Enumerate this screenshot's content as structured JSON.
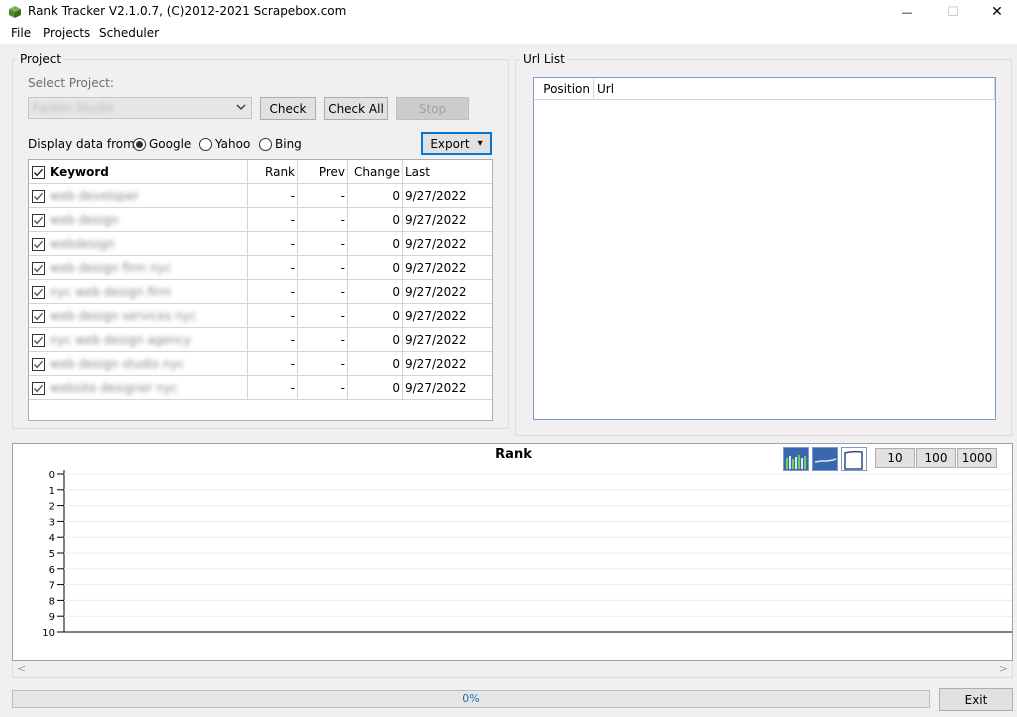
{
  "window": {
    "title": "Rank Tracker V2.1.0.7, (C)2012-2021 Scrapebox.com",
    "minimize_glyph": "—",
    "maximize_glyph": "☐",
    "close_glyph": "✕"
  },
  "menu": {
    "file": "File",
    "projects": "Projects",
    "scheduler": "Scheduler"
  },
  "project": {
    "group_label": "Project",
    "select_label": "Select Project:",
    "selected_project": "Fanbin Studio",
    "check_label": "Check",
    "check_all_label": "Check All",
    "stop_label": "Stop",
    "display_from_label": "Display data from:",
    "sources": [
      {
        "label": "Google",
        "selected": true
      },
      {
        "label": "Yahoo",
        "selected": false
      },
      {
        "label": "Bing",
        "selected": false
      }
    ],
    "export_label": "Export",
    "export_arrow": "▾"
  },
  "keyword_table": {
    "columns": {
      "keyword": "Keyword",
      "rank": "Rank",
      "prev": "Prev",
      "change": "Change",
      "last": "Last"
    },
    "rows": [
      {
        "keyword": "web developer",
        "rank": "-",
        "prev": "-",
        "change": "0",
        "last": "9/27/2022"
      },
      {
        "keyword": "web design",
        "rank": "-",
        "prev": "-",
        "change": "0",
        "last": "9/27/2022"
      },
      {
        "keyword": "webdesign",
        "rank": "-",
        "prev": "-",
        "change": "0",
        "last": "9/27/2022"
      },
      {
        "keyword": "web design firm nyc",
        "rank": "-",
        "prev": "-",
        "change": "0",
        "last": "9/27/2022"
      },
      {
        "keyword": "nyc web design firm",
        "rank": "-",
        "prev": "-",
        "change": "0",
        "last": "9/27/2022"
      },
      {
        "keyword": "web design services nyc",
        "rank": "-",
        "prev": "-",
        "change": "0",
        "last": "9/27/2022"
      },
      {
        "keyword": "nyc web design agency",
        "rank": "-",
        "prev": "-",
        "change": "0",
        "last": "9/27/2022"
      },
      {
        "keyword": "web design studio nyc",
        "rank": "-",
        "prev": "-",
        "change": "0",
        "last": "9/27/2022"
      },
      {
        "keyword": "website designer nyc",
        "rank": "-",
        "prev": "-",
        "change": "0",
        "last": "9/27/2022"
      }
    ]
  },
  "url_list": {
    "group_label": "Url List",
    "columns": {
      "position": "Position",
      "url": "Url"
    }
  },
  "chart_data": {
    "type": "line",
    "title": "Rank",
    "xlabel": "",
    "ylabel": "",
    "ylim": [
      0,
      10
    ],
    "y_inverted": true,
    "yticks": [
      "0",
      "1",
      "2",
      "3",
      "4",
      "5",
      "6",
      "7",
      "8",
      "9",
      "10"
    ],
    "grid": true,
    "series": []
  },
  "chart_controls": {
    "scale_10": "10",
    "scale_100": "100",
    "scale_1000": "1000"
  },
  "scrollbar": {
    "left_glyph": "<",
    "right_glyph": ">"
  },
  "progress": {
    "value": 0,
    "text": "0%"
  },
  "exit_label": "Exit",
  "colors": {
    "accent": "#0078d7",
    "progress_text": "#1c6fb3",
    "chart_icon_blue": "#3a68b0"
  }
}
